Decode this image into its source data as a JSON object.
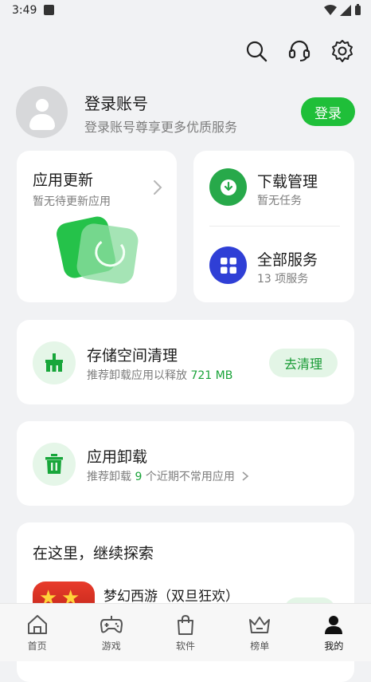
{
  "status_bar": {
    "time": "3:49"
  },
  "header_icons": [
    "search-icon",
    "headset-icon",
    "settings-gear-icon"
  ],
  "profile": {
    "title": "登录账号",
    "subtitle": "登录账号尊享更多优质服务",
    "login_label": "登录"
  },
  "app_update": {
    "title": "应用更新",
    "subtitle": "暂无待更新应用"
  },
  "services": {
    "download": {
      "title": "下载管理",
      "subtitle": "暂无任务"
    },
    "all": {
      "title": "全部服务",
      "subtitle": "13 项服务"
    }
  },
  "storage": {
    "title": "存储空间清理",
    "subtitle_prefix": "推荐卸载应用以释放 ",
    "subtitle_value": "721 MB",
    "button": "去清理"
  },
  "uninstall": {
    "title": "应用卸载",
    "subtitle_prefix": "推荐卸载 ",
    "subtitle_count": "9",
    "subtitle_suffix": " 个近期不常用应用"
  },
  "explore": {
    "title": "在这里，继续探索",
    "item_name": "梦幻西游（双旦狂欢）"
  },
  "bottom_nav": [
    {
      "label": "首页",
      "icon": "home-icon"
    },
    {
      "label": "游戏",
      "icon": "gamepad-icon"
    },
    {
      "label": "软件",
      "icon": "shopping-bag-icon"
    },
    {
      "label": "榜单",
      "icon": "crown-icon"
    },
    {
      "label": "我的",
      "icon": "person-icon"
    }
  ],
  "colors": {
    "accent": "#1fbf39",
    "download_circle": "#27a94a",
    "services_circle": "#2f3fd6",
    "background": "#f1f2f4"
  }
}
